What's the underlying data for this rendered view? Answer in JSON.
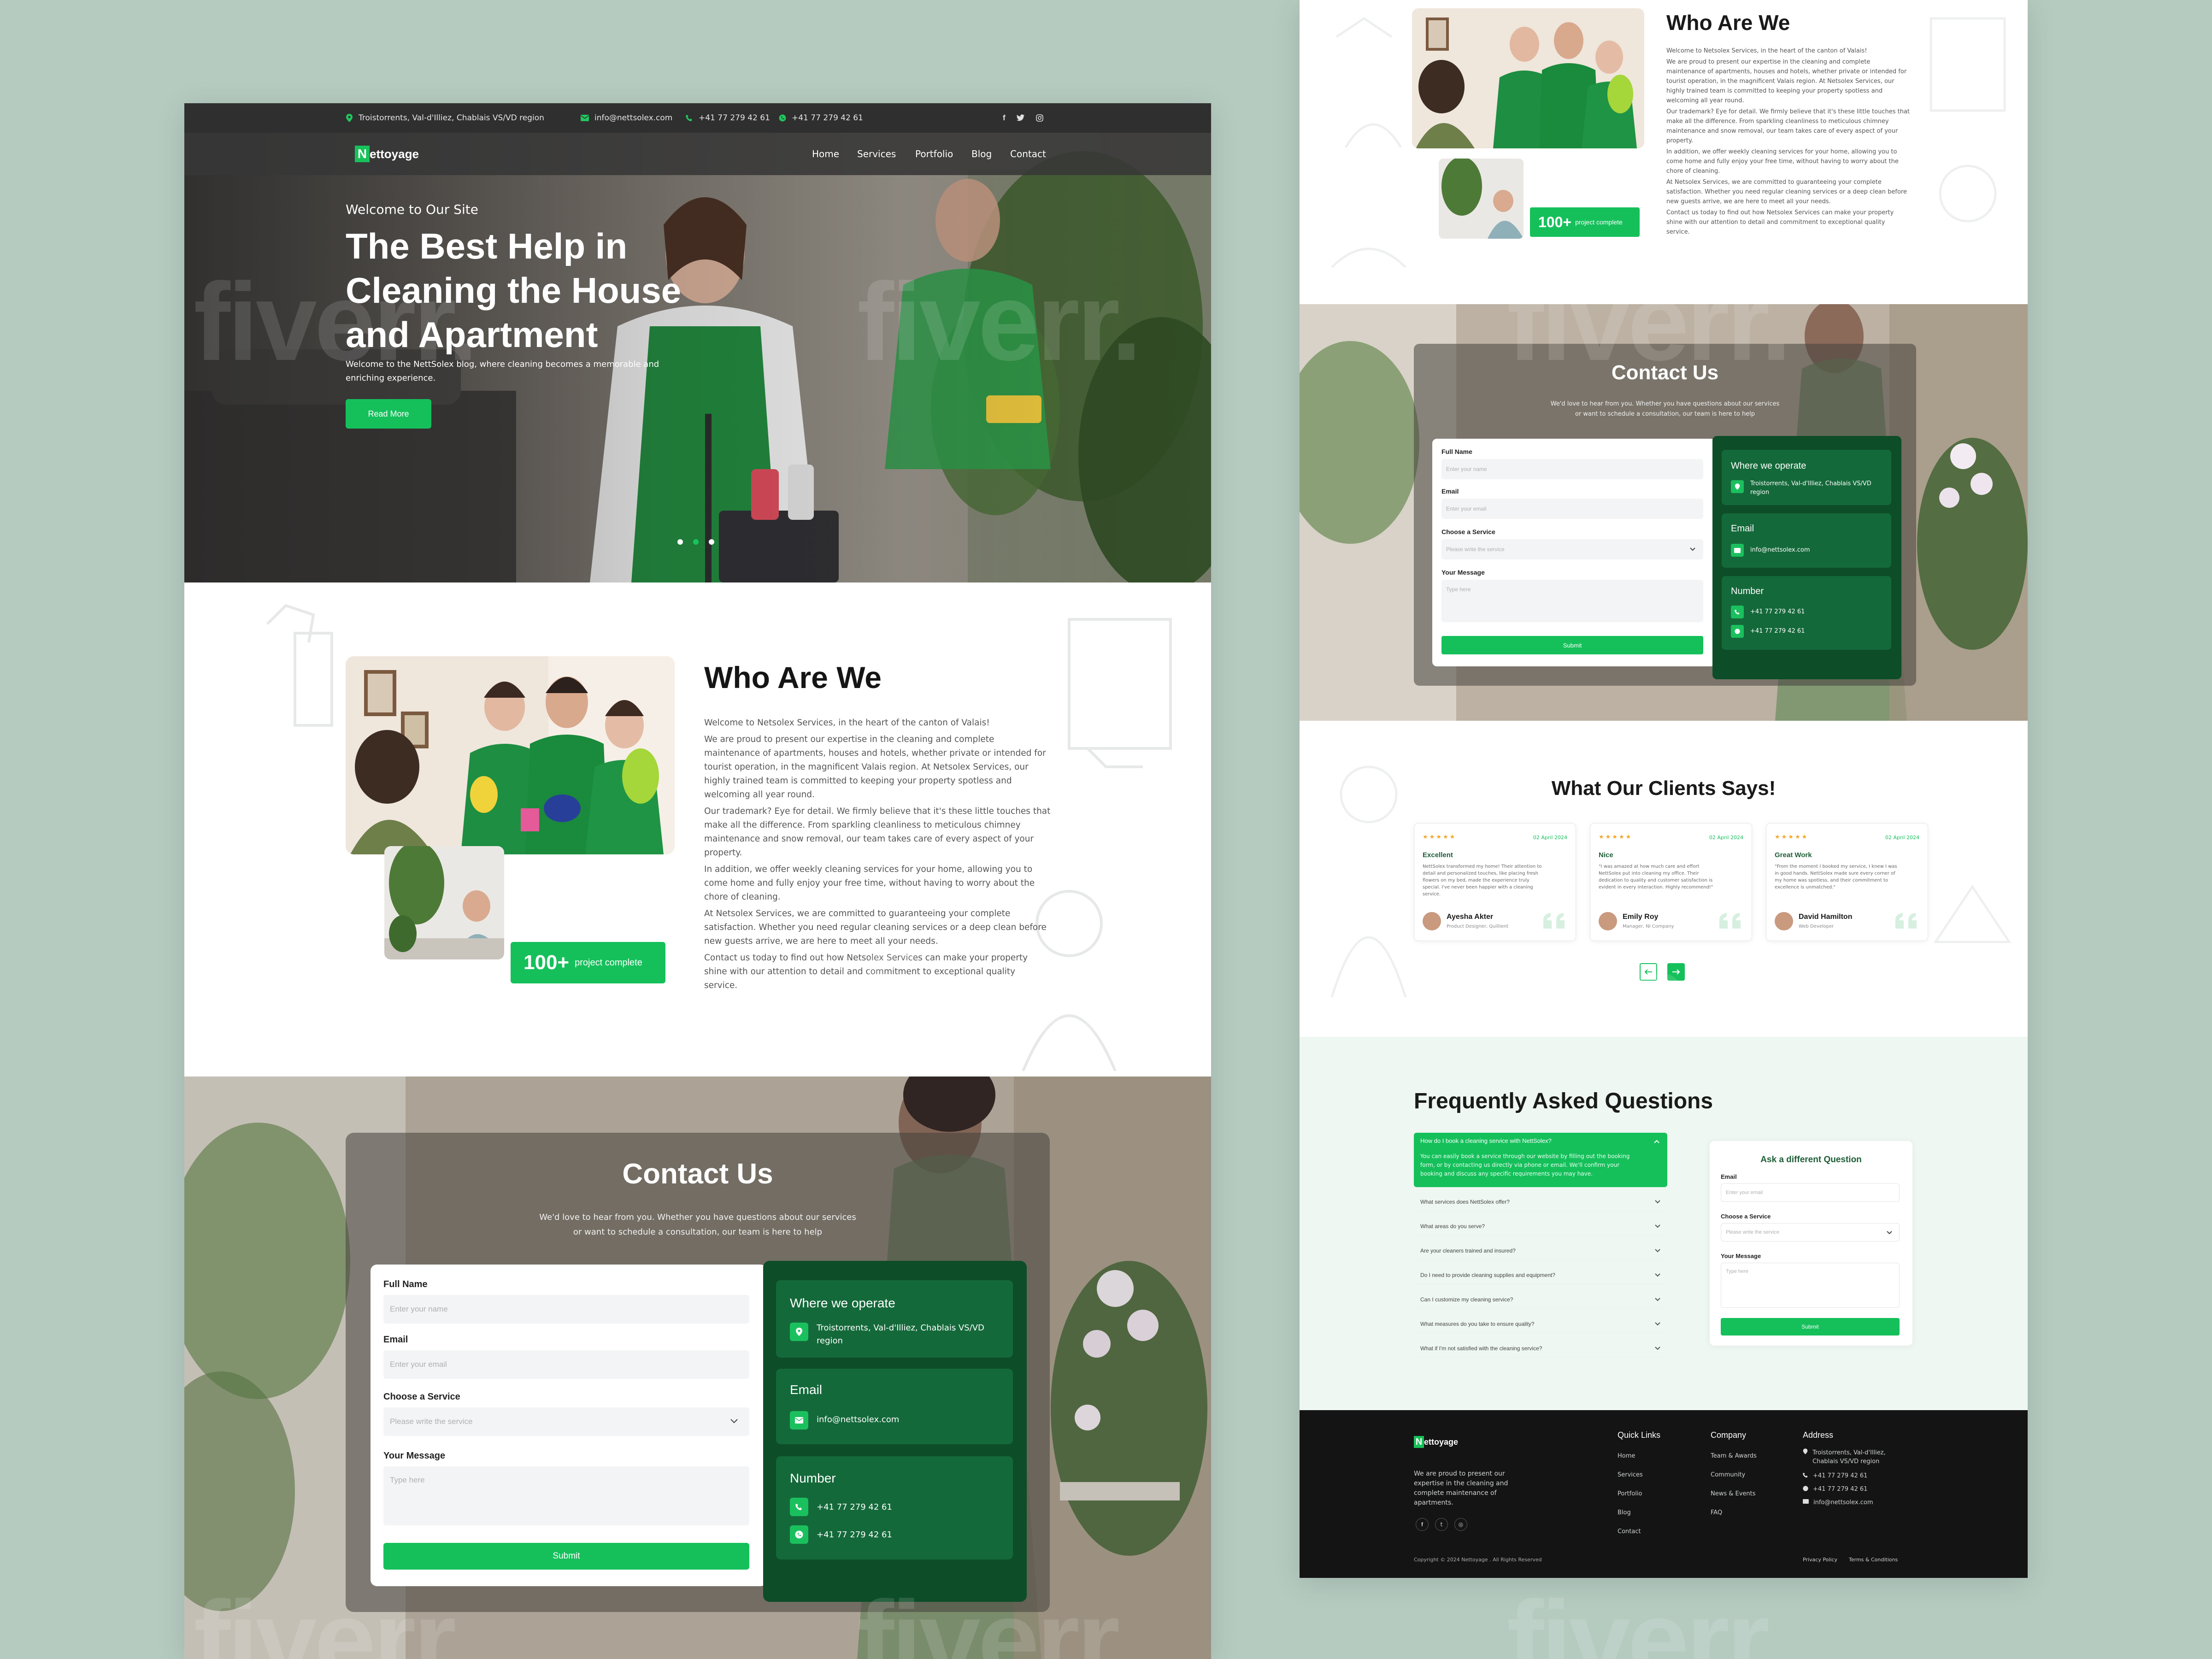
{
  "brand": {
    "logo_letter": "N",
    "logo_rest": "ettoyage",
    "accent": "#15c05b",
    "dark_green": "#0d4d28"
  },
  "topbar": {
    "address": "Troistorrents, Val-d'Illiez, Chablais VS/VD region",
    "email": "info@nettsolex.com",
    "phone": "+41 77 279 42 61",
    "whatsapp": "+41 77 279 42 61",
    "social_icons": [
      "facebook-icon",
      "twitter-icon",
      "instagram-icon"
    ],
    "social_glyphs": [
      "f",
      "t",
      "◎"
    ]
  },
  "nav": {
    "items": [
      "Home",
      "Services",
      "Portfolio",
      "Blog",
      "Contact"
    ]
  },
  "hero": {
    "kicker": "Welcome to Our Site",
    "title_lines": [
      "The Best Help in",
      "Cleaning the House",
      "and Apartment"
    ],
    "subtitle_lines": [
      "Welcome to the NettSolex blog, where cleaning becomes a memorable and",
      "enriching experience."
    ],
    "cta": "Read More",
    "slide_count": 3,
    "active_slide": 2
  },
  "about": {
    "title": "Who Are We",
    "badge_number": "100+",
    "badge_text": "project complete",
    "paragraphs": [
      [
        "Welcome to Netsolex Services, in the heart of the canton of Valais!"
      ],
      [
        "We are proud to present our expertise in the cleaning and complete",
        "maintenance of apartments, houses and hotels, whether private or intended for",
        "tourist operation, in the magnificent Valais region. At Netsolex Services, our",
        "highly trained team is committed to keeping your property spotless and",
        "welcoming all year round."
      ],
      [
        "Our trademark? Eye for detail. We firmly believe that it's these little touches that",
        "make all the difference. From sparkling cleanliness to meticulous chimney",
        "maintenance and snow removal, our team takes care of every aspect of your",
        "property."
      ],
      [
        "In addition, we offer weekly cleaning services for your home, allowing you to",
        "come home and fully enjoy your free time, without having to worry about the",
        "chore of cleaning."
      ],
      [
        "At Netsolex Services, we are committed to guaranteeing your complete",
        "satisfaction. Whether you need regular cleaning services or a deep clean before",
        "new guests arrive, we are here to meet all your needs."
      ],
      [
        "Contact us today to find out how Netsolex Services can make your property",
        "shine with our attention to detail and commitment to exceptional quality",
        "service."
      ]
    ]
  },
  "contact": {
    "title": "Contact Us",
    "subtitle_lines": [
      "We'd love to hear from you. Whether you have questions about our services",
      "or want to schedule a consultation, our team is here to help"
    ],
    "form": {
      "full_name_label": "Full Name",
      "full_name_placeholder": "Enter your name",
      "email_label": "Email",
      "email_placeholder": "Enter your email",
      "service_label": "Choose a Service",
      "service_placeholder": "Please write the service",
      "message_label": "Your Message",
      "message_placeholder": "Type here",
      "submit": "Submit"
    },
    "info": {
      "where_title": "Where we operate",
      "where_lines": [
        "Troistorrents, Val-d'Illiez, Chablais VS/VD",
        "region"
      ],
      "email_title": "Email",
      "email_value": "info@nettsolex.com",
      "number_title": "Number",
      "phone": "+41 77 279 42 61",
      "whatsapp": "+41 77 279 42 61"
    }
  },
  "testimonials": {
    "title": "What Our Clients Says!",
    "items": [
      {
        "rating": 5,
        "date": "02 April 2024",
        "heading": "Excellent",
        "text": [
          "NettSolex transformed my home! Their attention to",
          "detail and personalized touches, like placing fresh",
          "flowers on my bed, made the experience truly",
          "special. I've never been happier with a cleaning",
          "service."
        ],
        "name": "Ayesha Akter",
        "role": "Product Designer, Quillient"
      },
      {
        "rating": 5,
        "date": "02 April 2024",
        "heading": "Nice",
        "text": [
          "\"I was amazed at how much care and effort",
          "NettSolex put into cleaning my office. Their",
          "dedication to quality and customer satisfaction is",
          "evident in every interaction. Highly recommend!\""
        ],
        "name": "Emily Roy",
        "role": "Manager, NI Company"
      },
      {
        "rating": 5,
        "date": "02 April 2024",
        "heading": "Great Work",
        "text": [
          "\"From the moment I booked my service, I knew I was",
          "in good hands. NettSolex made sure every corner of",
          "my home was spotless, and their commitment to",
          "excellence is unmatched.\""
        ],
        "name": "David Hamilton",
        "role": "Web Developer"
      }
    ]
  },
  "faq": {
    "title": "Frequently Asked Questions",
    "open_question": "How do I book a cleaning service with NettSolex?",
    "open_answer": [
      "You can easily book a service through our website by filling out the booking",
      "form, or by contacting us directly via phone or email. We'll confirm your",
      "booking and discuss any specific requirements you may have."
    ],
    "questions": [
      "What services does NettSolex offer?",
      "What areas do you serve?",
      "Are your cleaners trained and insured?",
      "Do I need to provide cleaning supplies and equipment?",
      "Can I customize my cleaning service?",
      "What measures do you take to ensure quality?",
      "What if I'm not satisfied with the cleaning service?"
    ],
    "ask_form": {
      "title": "Ask a different Question",
      "email_label": "Email",
      "email_placeholder": "Enter your email",
      "service_label": "Choose a Service",
      "service_placeholder": "Please write the service",
      "message_label": "Your Message",
      "message_placeholder": "Type here",
      "submit": "Submit"
    }
  },
  "footer": {
    "about_lines": [
      "We are proud to present our",
      "expertise in the cleaning and",
      "complete maintenance of",
      "apartments."
    ],
    "quick_links_title": "Quick Links",
    "quick_links": [
      "Home",
      "Services",
      "Portfolio",
      "Blog",
      "Contact"
    ],
    "company_title": "Company",
    "company_links": [
      "Team & Awards",
      "Community",
      "News & Events",
      "FAQ"
    ],
    "address_title": "Address",
    "address_lines": [
      "Troistorrents, Val-d'Illiez,",
      "Chablais VS/VD region"
    ],
    "phone": "+41 77 279 42 61",
    "whatsapp": "+41 77 279 42 61",
    "email": "info@nettsolex.com",
    "copyright": "Copyright © 2024 Nettoyage . All Rights Reserved",
    "privacy": "Privacy Policy",
    "terms": "Terms & Conditions"
  },
  "watermark": "fiverr."
}
